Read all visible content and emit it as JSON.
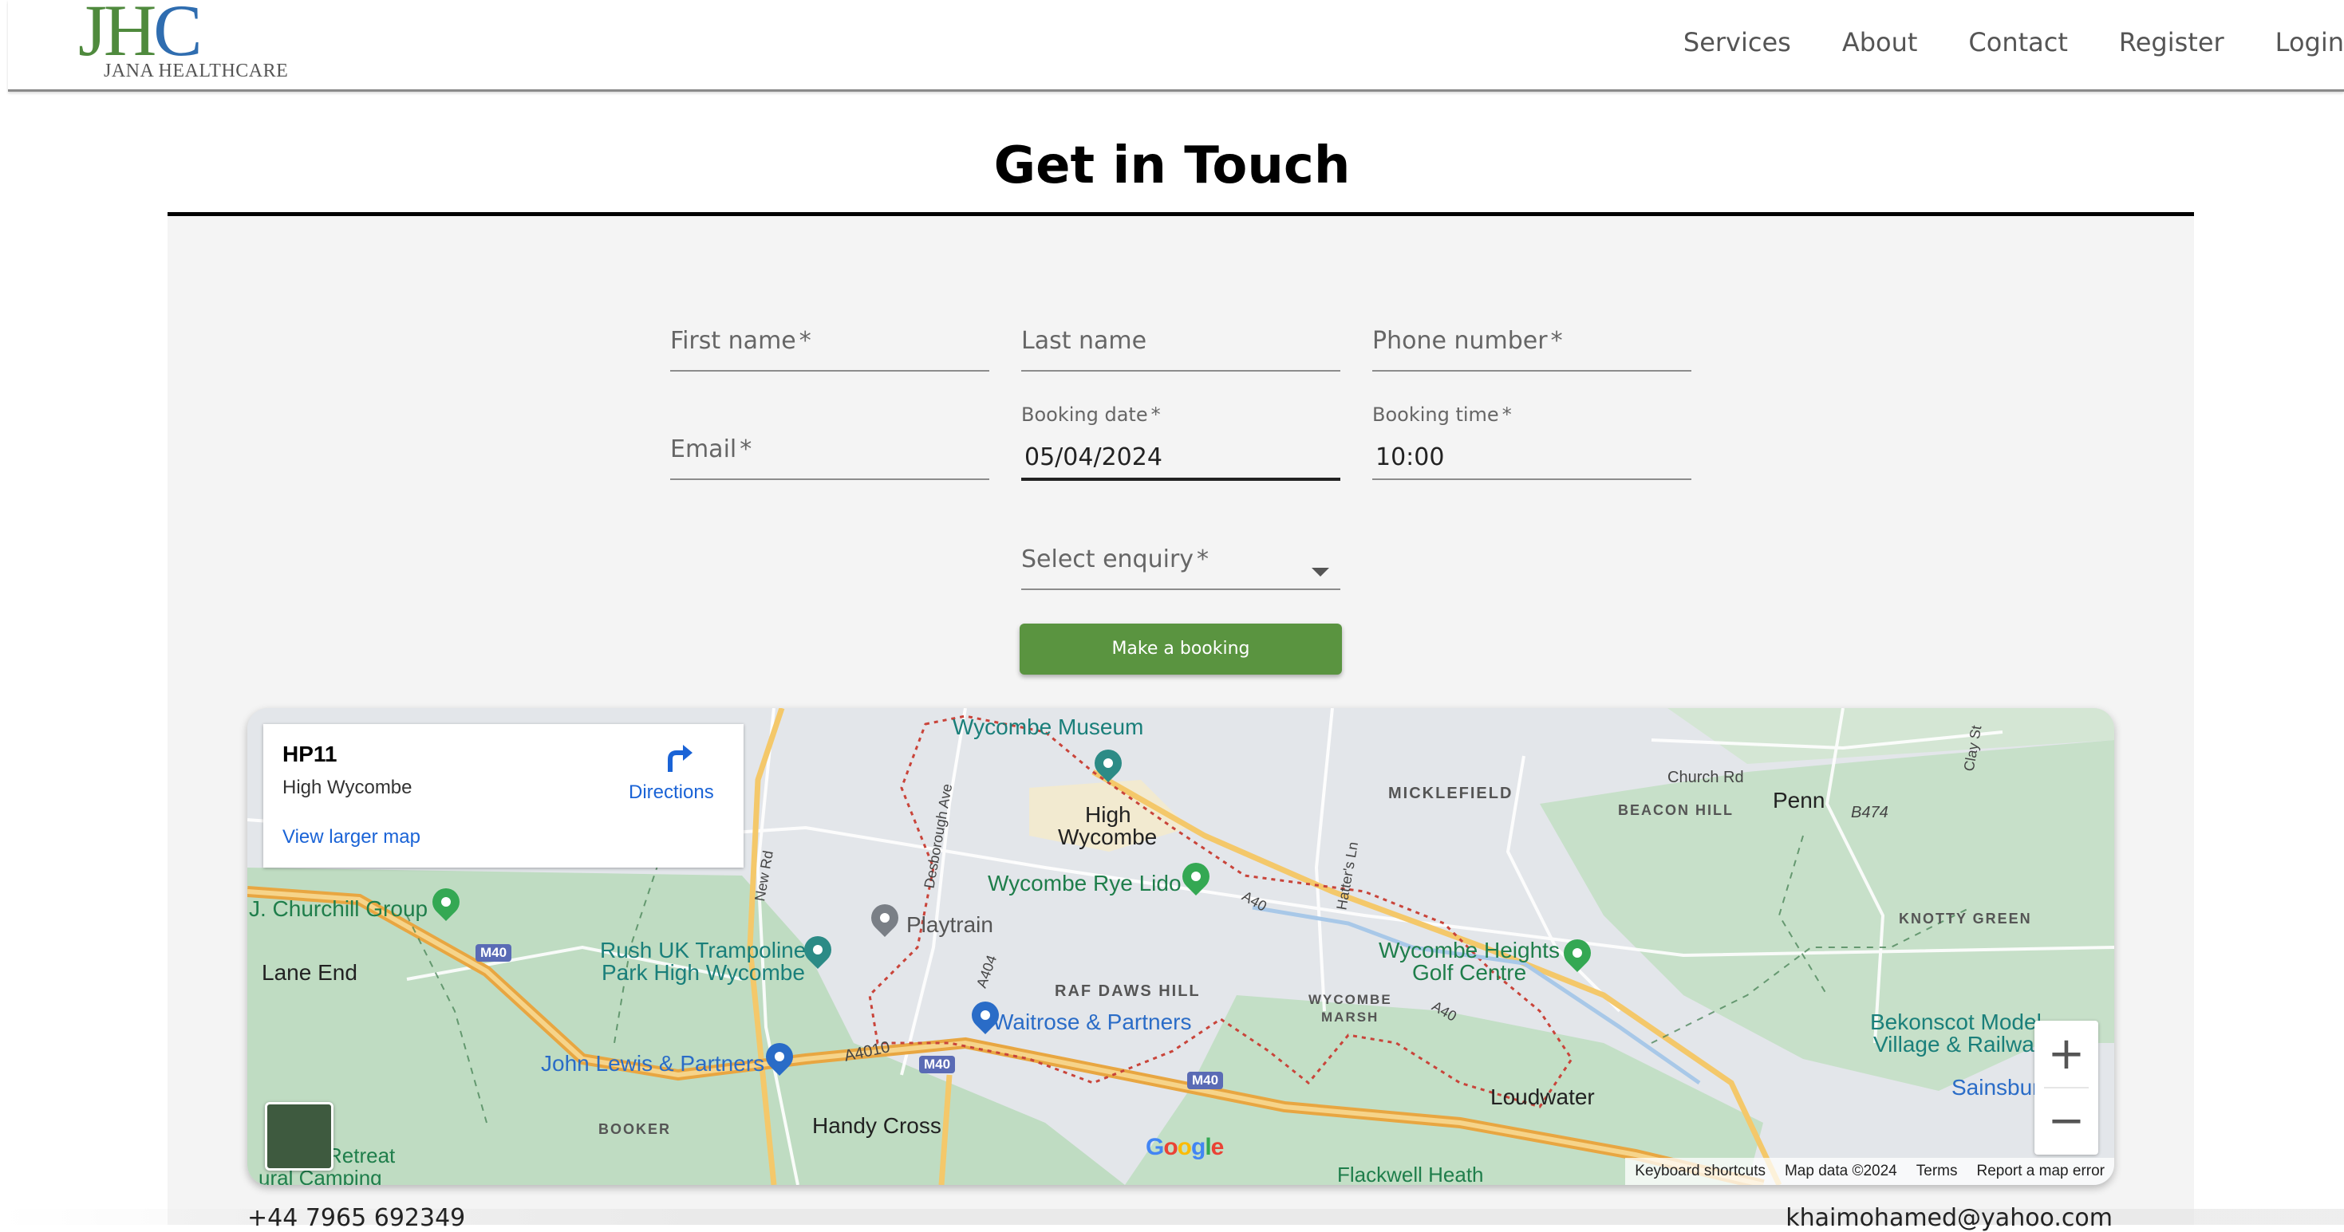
{
  "brand": {
    "monogram_j": "J",
    "monogram_h": "H",
    "monogram_c": "C",
    "name": "JANA HEALTHCARE"
  },
  "nav": {
    "items": [
      "Services",
      "About",
      "Contact",
      "Register",
      "Login"
    ]
  },
  "page": {
    "title": "Get in Touch"
  },
  "form": {
    "first_name": {
      "label": "First name",
      "required": "*"
    },
    "last_name": {
      "label": "Last name"
    },
    "phone": {
      "label": "Phone number",
      "required": "*"
    },
    "email": {
      "label": "Email",
      "required": "*"
    },
    "booking_date": {
      "label": "Booking date",
      "required": "*",
      "value": "05/04/2024"
    },
    "booking_time": {
      "label": "Booking time",
      "required": "*",
      "value": "10:00"
    },
    "enquiry": {
      "label": "Select enquiry",
      "required": "*"
    },
    "submit_label": "Make a booking"
  },
  "map": {
    "card": {
      "postcode": "HP11",
      "town": "High Wycombe",
      "directions": "Directions",
      "larger_map": "View larger map"
    },
    "places": {
      "wycombe_museum": "Wycombe Museum",
      "high_wycombe_1": "High",
      "high_wycombe_2": "Wycombe",
      "micklefield": "MICKLEFIELD",
      "church_rd": "Church Rd",
      "beacon_hill": "BEACON HILL",
      "penn": "Penn",
      "b474": "B474",
      "clay_st": "Clay St",
      "churchill_group": "J. Churchill Group",
      "lane_end": "Lane End",
      "wycombe_rye_lido": "Wycombe Rye Lido",
      "playtrain": "Playtrain",
      "rush_uk_1": "Rush UK Trampoline",
      "rush_uk_2": "Park High Wycombe",
      "knotty_green": "KNOTTY GREEN",
      "wycombe_heights_1": "Wycombe Heights",
      "wycombe_heights_2": "Golf Centre",
      "raf_daws_hill": "RAF DAWS HILL",
      "wycombe_marsh_1": "WYCOMBE",
      "wycombe_marsh_2": "MARSH",
      "waitrose": "Waitrose & Partners",
      "bekonscot_1": "Bekonscot Model",
      "bekonscot_2": "Village & Railway",
      "john_lewis": "John Lewis & Partners",
      "a4010": "A4010",
      "m40_a": "M40",
      "m40_b": "M40",
      "m40_c": "M40",
      "a40_a": "A40",
      "a40_b": "A40",
      "sainsbury": "Sainsbur",
      "loudwater": "Loudwater",
      "booker": "BOOKER",
      "handy_cross": "Handy Cross",
      "retreat": "Retreat",
      "rural_camping": "ural Camping",
      "flackwell_heath": "Flackwell Heath",
      "desborough_ave": "Desborough Ave",
      "new_rd": "New Rd",
      "hatters_ln": "Hatter's Ln",
      "a404": "A404"
    },
    "zoom_in": "+",
    "zoom_out": "−",
    "google": "Google",
    "attribution": [
      "Keyboard shortcuts",
      "Map data ©2024",
      "Terms",
      "Report a map error"
    ]
  },
  "footer": {
    "phone": "+44 7965 692349",
    "email": "khaimohamed@yahoo.com"
  },
  "colors": {
    "brand_green": "#5a9440",
    "brand_blue": "#2f6db0",
    "link_blue": "#1a63d6"
  },
  "icons": {
    "directions": "directions-icon",
    "dropdown": "chevron-down-icon",
    "pin": "map-pin-icon"
  }
}
